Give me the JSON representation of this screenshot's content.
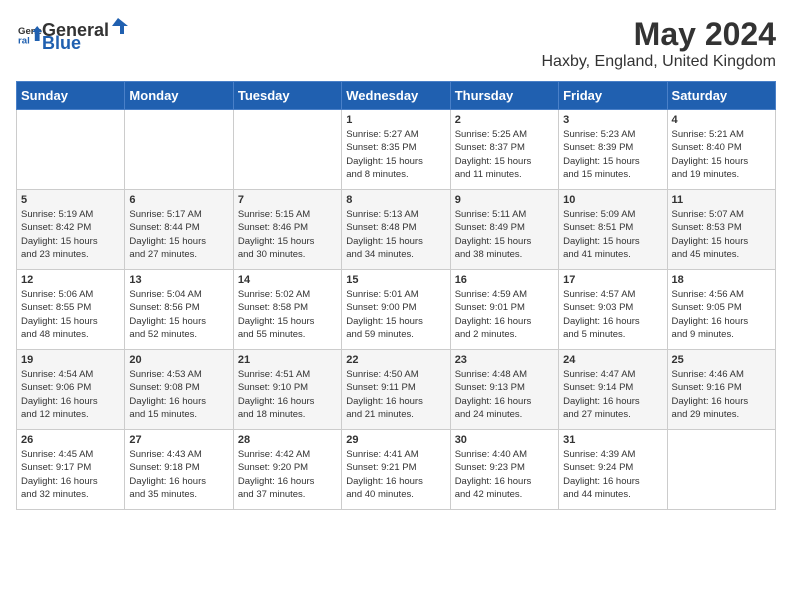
{
  "header": {
    "logo_general": "General",
    "logo_blue": "Blue",
    "month_title": "May 2024",
    "location": "Haxby, England, United Kingdom"
  },
  "weekdays": [
    "Sunday",
    "Monday",
    "Tuesday",
    "Wednesday",
    "Thursday",
    "Friday",
    "Saturday"
  ],
  "weeks": [
    [
      {
        "day": "",
        "info": ""
      },
      {
        "day": "",
        "info": ""
      },
      {
        "day": "",
        "info": ""
      },
      {
        "day": "1",
        "info": "Sunrise: 5:27 AM\nSunset: 8:35 PM\nDaylight: 15 hours\nand 8 minutes."
      },
      {
        "day": "2",
        "info": "Sunrise: 5:25 AM\nSunset: 8:37 PM\nDaylight: 15 hours\nand 11 minutes."
      },
      {
        "day": "3",
        "info": "Sunrise: 5:23 AM\nSunset: 8:39 PM\nDaylight: 15 hours\nand 15 minutes."
      },
      {
        "day": "4",
        "info": "Sunrise: 5:21 AM\nSunset: 8:40 PM\nDaylight: 15 hours\nand 19 minutes."
      }
    ],
    [
      {
        "day": "5",
        "info": "Sunrise: 5:19 AM\nSunset: 8:42 PM\nDaylight: 15 hours\nand 23 minutes."
      },
      {
        "day": "6",
        "info": "Sunrise: 5:17 AM\nSunset: 8:44 PM\nDaylight: 15 hours\nand 27 minutes."
      },
      {
        "day": "7",
        "info": "Sunrise: 5:15 AM\nSunset: 8:46 PM\nDaylight: 15 hours\nand 30 minutes."
      },
      {
        "day": "8",
        "info": "Sunrise: 5:13 AM\nSunset: 8:48 PM\nDaylight: 15 hours\nand 34 minutes."
      },
      {
        "day": "9",
        "info": "Sunrise: 5:11 AM\nSunset: 8:49 PM\nDaylight: 15 hours\nand 38 minutes."
      },
      {
        "day": "10",
        "info": "Sunrise: 5:09 AM\nSunset: 8:51 PM\nDaylight: 15 hours\nand 41 minutes."
      },
      {
        "day": "11",
        "info": "Sunrise: 5:07 AM\nSunset: 8:53 PM\nDaylight: 15 hours\nand 45 minutes."
      }
    ],
    [
      {
        "day": "12",
        "info": "Sunrise: 5:06 AM\nSunset: 8:55 PM\nDaylight: 15 hours\nand 48 minutes."
      },
      {
        "day": "13",
        "info": "Sunrise: 5:04 AM\nSunset: 8:56 PM\nDaylight: 15 hours\nand 52 minutes."
      },
      {
        "day": "14",
        "info": "Sunrise: 5:02 AM\nSunset: 8:58 PM\nDaylight: 15 hours\nand 55 minutes."
      },
      {
        "day": "15",
        "info": "Sunrise: 5:01 AM\nSunset: 9:00 PM\nDaylight: 15 hours\nand 59 minutes."
      },
      {
        "day": "16",
        "info": "Sunrise: 4:59 AM\nSunset: 9:01 PM\nDaylight: 16 hours\nand 2 minutes."
      },
      {
        "day": "17",
        "info": "Sunrise: 4:57 AM\nSunset: 9:03 PM\nDaylight: 16 hours\nand 5 minutes."
      },
      {
        "day": "18",
        "info": "Sunrise: 4:56 AM\nSunset: 9:05 PM\nDaylight: 16 hours\nand 9 minutes."
      }
    ],
    [
      {
        "day": "19",
        "info": "Sunrise: 4:54 AM\nSunset: 9:06 PM\nDaylight: 16 hours\nand 12 minutes."
      },
      {
        "day": "20",
        "info": "Sunrise: 4:53 AM\nSunset: 9:08 PM\nDaylight: 16 hours\nand 15 minutes."
      },
      {
        "day": "21",
        "info": "Sunrise: 4:51 AM\nSunset: 9:10 PM\nDaylight: 16 hours\nand 18 minutes."
      },
      {
        "day": "22",
        "info": "Sunrise: 4:50 AM\nSunset: 9:11 PM\nDaylight: 16 hours\nand 21 minutes."
      },
      {
        "day": "23",
        "info": "Sunrise: 4:48 AM\nSunset: 9:13 PM\nDaylight: 16 hours\nand 24 minutes."
      },
      {
        "day": "24",
        "info": "Sunrise: 4:47 AM\nSunset: 9:14 PM\nDaylight: 16 hours\nand 27 minutes."
      },
      {
        "day": "25",
        "info": "Sunrise: 4:46 AM\nSunset: 9:16 PM\nDaylight: 16 hours\nand 29 minutes."
      }
    ],
    [
      {
        "day": "26",
        "info": "Sunrise: 4:45 AM\nSunset: 9:17 PM\nDaylight: 16 hours\nand 32 minutes."
      },
      {
        "day": "27",
        "info": "Sunrise: 4:43 AM\nSunset: 9:18 PM\nDaylight: 16 hours\nand 35 minutes."
      },
      {
        "day": "28",
        "info": "Sunrise: 4:42 AM\nSunset: 9:20 PM\nDaylight: 16 hours\nand 37 minutes."
      },
      {
        "day": "29",
        "info": "Sunrise: 4:41 AM\nSunset: 9:21 PM\nDaylight: 16 hours\nand 40 minutes."
      },
      {
        "day": "30",
        "info": "Sunrise: 4:40 AM\nSunset: 9:23 PM\nDaylight: 16 hours\nand 42 minutes."
      },
      {
        "day": "31",
        "info": "Sunrise: 4:39 AM\nSunset: 9:24 PM\nDaylight: 16 hours\nand 44 minutes."
      },
      {
        "day": "",
        "info": ""
      }
    ]
  ]
}
